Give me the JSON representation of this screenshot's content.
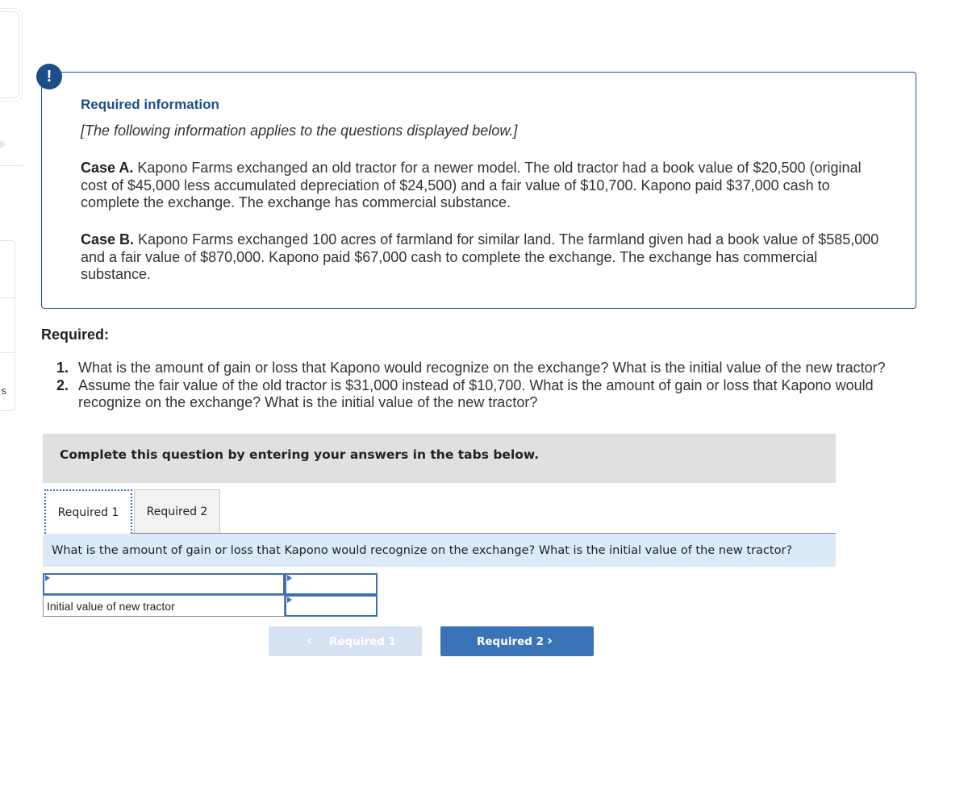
{
  "sidebar": {
    "partial_label": "s"
  },
  "info": {
    "title": "Required information",
    "note": "[The following information applies to the questions displayed below.]",
    "case_a": {
      "label": "Case A.",
      "text": " Kapono Farms exchanged an old tractor for a newer model. The old tractor had a book value of $20,500 (original cost of $45,000 less accumulated depreciation of $24,500) and a fair value of $10,700. Kapono paid $37,000 cash to complete the exchange. The exchange has commercial substance."
    },
    "case_b": {
      "label": "Case B.",
      "text": " Kapono Farms exchanged 100 acres of farmland for similar land. The farmland given had a book value of $585,000 and a fair value of $870,000. Kapono paid $67,000 cash to complete the exchange. The exchange has commercial substance."
    }
  },
  "required": {
    "heading": "Required:",
    "items": [
      {
        "num": "1.",
        "text": "What is the amount of gain or loss that Kapono would recognize on the exchange? What is the initial value of the new tractor?"
      },
      {
        "num": "2.",
        "text": "Assume the fair value of the old tractor is $31,000 instead of $10,700. What is the amount of gain or loss that Kapono would recognize on the exchange? What is the initial value of the new tractor?"
      }
    ]
  },
  "instructions": "Complete this question by entering your answers in the tabs below.",
  "tabs": [
    {
      "label": "Required 1",
      "active": true
    },
    {
      "label": "Required 2",
      "active": false
    }
  ],
  "question": "What is the amount of gain or loss that Kapono would recognize on the exchange? What is the initial value of the new tractor?",
  "answer_table": {
    "rows": [
      {
        "label": "",
        "value": ""
      },
      {
        "label": "Initial value of new tractor",
        "value": ""
      }
    ]
  },
  "navigation": {
    "prev_label": "Required 1",
    "prev_icon": "chevron-left-icon",
    "next_label": "Required 2",
    "next_icon": "chevron-right-icon",
    "prev_disabled": true
  },
  "colors": {
    "brand_navy": "#1a4f8a",
    "button_blue": "#3b73b9",
    "question_bg": "#dbeaf7",
    "instruction_bg": "#e0e0e0"
  }
}
